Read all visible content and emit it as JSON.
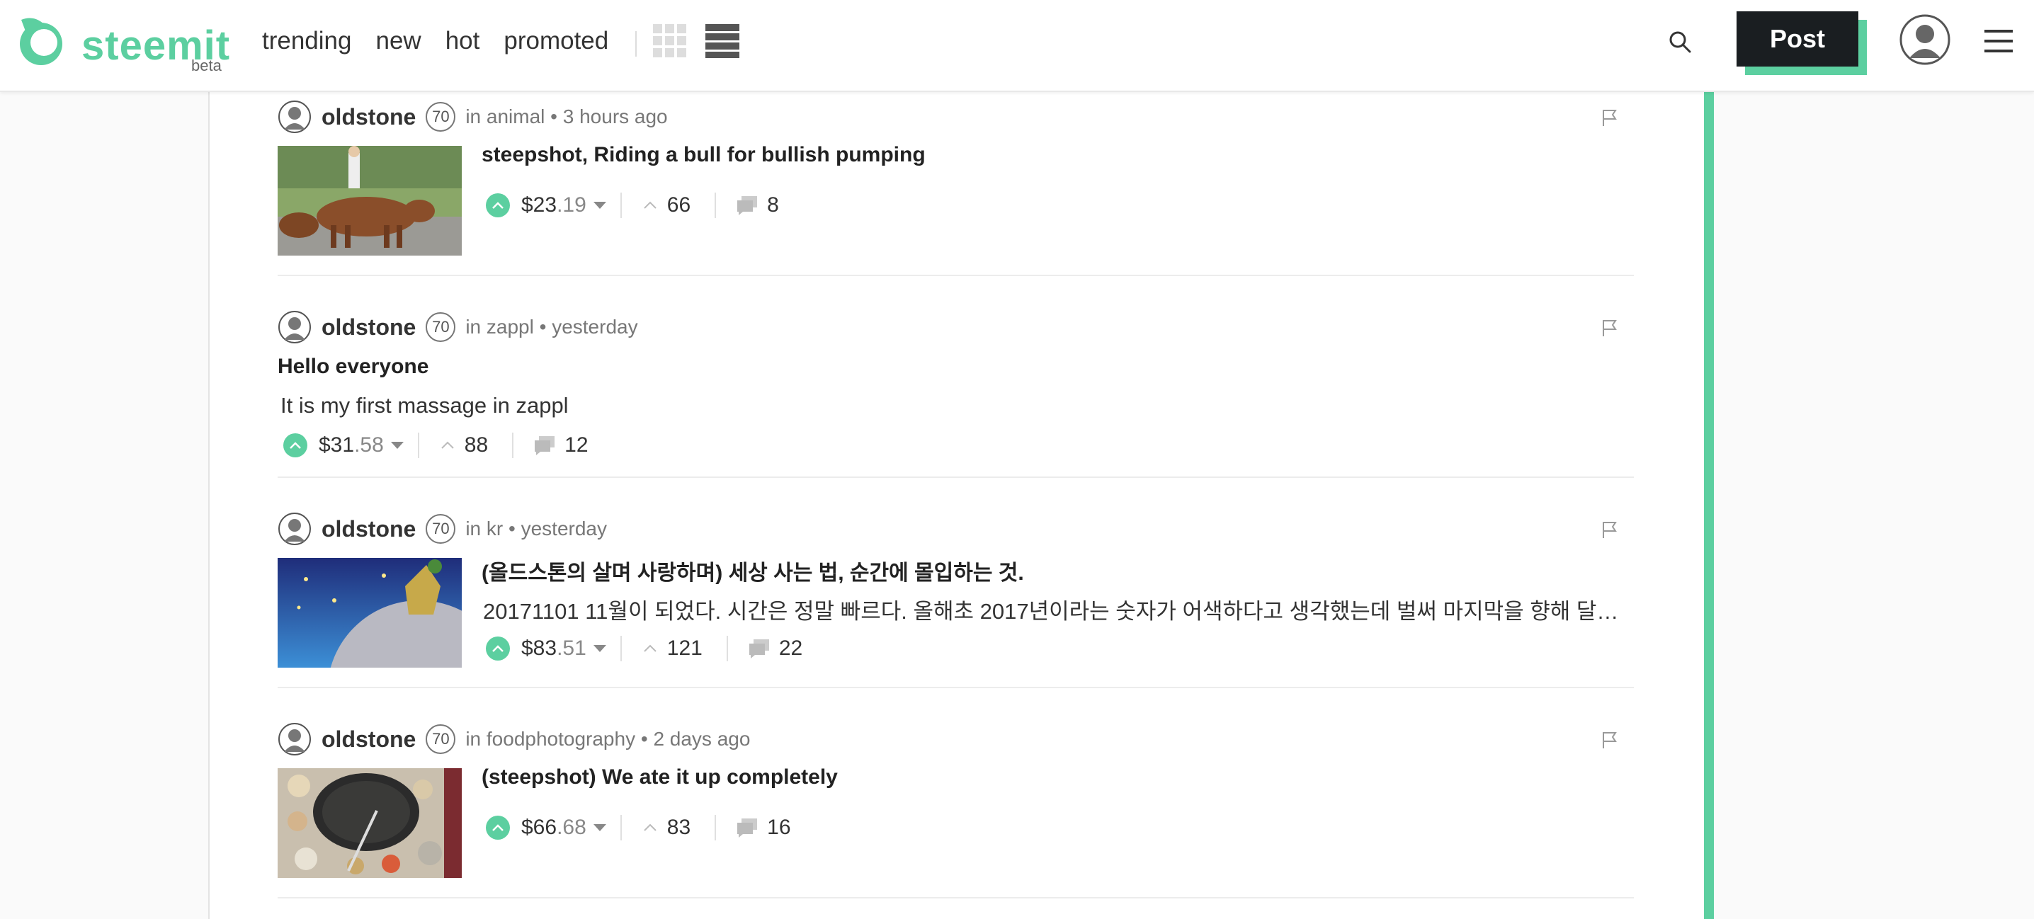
{
  "header": {
    "logo_text": "steemit",
    "logo_sub": "beta",
    "nav": [
      "trending",
      "new",
      "hot",
      "promoted"
    ],
    "post_label": "Post"
  },
  "colors": {
    "accent": "#5ccfa0",
    "dark": "#1a1e21"
  },
  "posts": [
    {
      "author": "oldstone",
      "rep": "70",
      "meta": "in animal • 3 hours ago",
      "title": "steepshot, Riding a bull for bullish pumping",
      "body": "",
      "payout_main": "$23",
      "payout_cents": ".19",
      "votes": "66",
      "comments": "8",
      "thumbnail": "bull"
    },
    {
      "author": "oldstone",
      "rep": "70",
      "meta": "in zappl • yesterday",
      "title": "Hello everyone",
      "body": "It is my first massage in zappl",
      "payout_main": "$31",
      "payout_cents": ".58",
      "votes": "88",
      "comments": "12",
      "thumbnail": ""
    },
    {
      "author": "oldstone",
      "rep": "70",
      "meta": "in kr • yesterday",
      "title": "(올드스톤의 살며 사랑하며) 세상 사는 법, 순간에 몰입하는 것.",
      "body": "20171101 11월이 되었다. 시간은 정말 빠르다. 올해초 2017년이라는 숫자가 어색하다고 생각했는데 벌써 마지막을 향해 달리…",
      "payout_main": "$83",
      "payout_cents": ".51",
      "votes": "121",
      "comments": "22",
      "thumbnail": "night"
    },
    {
      "author": "oldstone",
      "rep": "70",
      "meta": "in foodphotography • 2 days ago",
      "title": "(steepshot) We ate it up completely",
      "body": "",
      "payout_main": "$66",
      "payout_cents": ".68",
      "votes": "83",
      "comments": "16",
      "thumbnail": "food"
    }
  ]
}
